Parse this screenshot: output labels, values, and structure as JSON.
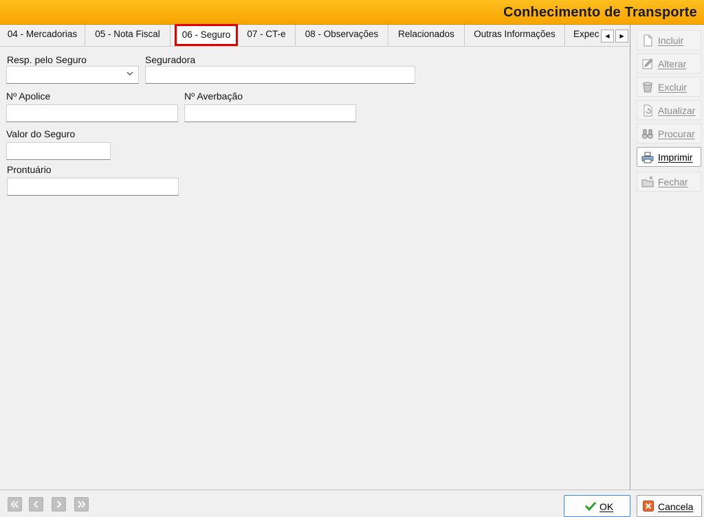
{
  "window": {
    "title": "Conhecimento de Transporte"
  },
  "tabs": [
    {
      "label": "04 - Mercadorias"
    },
    {
      "label": "05 - Nota Fiscal"
    },
    {
      "label": "06 - Seguro"
    },
    {
      "label": "07 - CT-e"
    },
    {
      "label": "08 - Observações"
    },
    {
      "label": "Relacionados"
    },
    {
      "label": "Outras Informações"
    },
    {
      "label": "Expec"
    }
  ],
  "tab_scroll": {
    "left": "◀",
    "right": "▶"
  },
  "form": {
    "resp_seguro": {
      "label": "Resp. pelo Seguro",
      "value": ""
    },
    "seguradora": {
      "label": "Seguradora",
      "value": ""
    },
    "n_apolice": {
      "label": "Nº Apolice",
      "value": ""
    },
    "n_averbacao": {
      "label": "Nº Averbação",
      "value": ""
    },
    "valor_seguro": {
      "label": "Valor do Seguro",
      "value": ""
    },
    "prontuario": {
      "label": "Prontuário",
      "value": ""
    }
  },
  "sidebar": {
    "incluir": "Incluir",
    "alterar": "Alterar",
    "excluir": "Excluir",
    "atualizar": "Atualizar",
    "procurar": "Procurar",
    "imprimir": "Imprimir",
    "fechar": "Fechar"
  },
  "footer": {
    "ok": "OK",
    "cancela": "Cancela"
  },
  "colors": {
    "titlebar": "#f7a400",
    "active_tab_border": "#e00000",
    "ok_check": "#2e9e2e",
    "cancel_icon": "#e8672a"
  }
}
